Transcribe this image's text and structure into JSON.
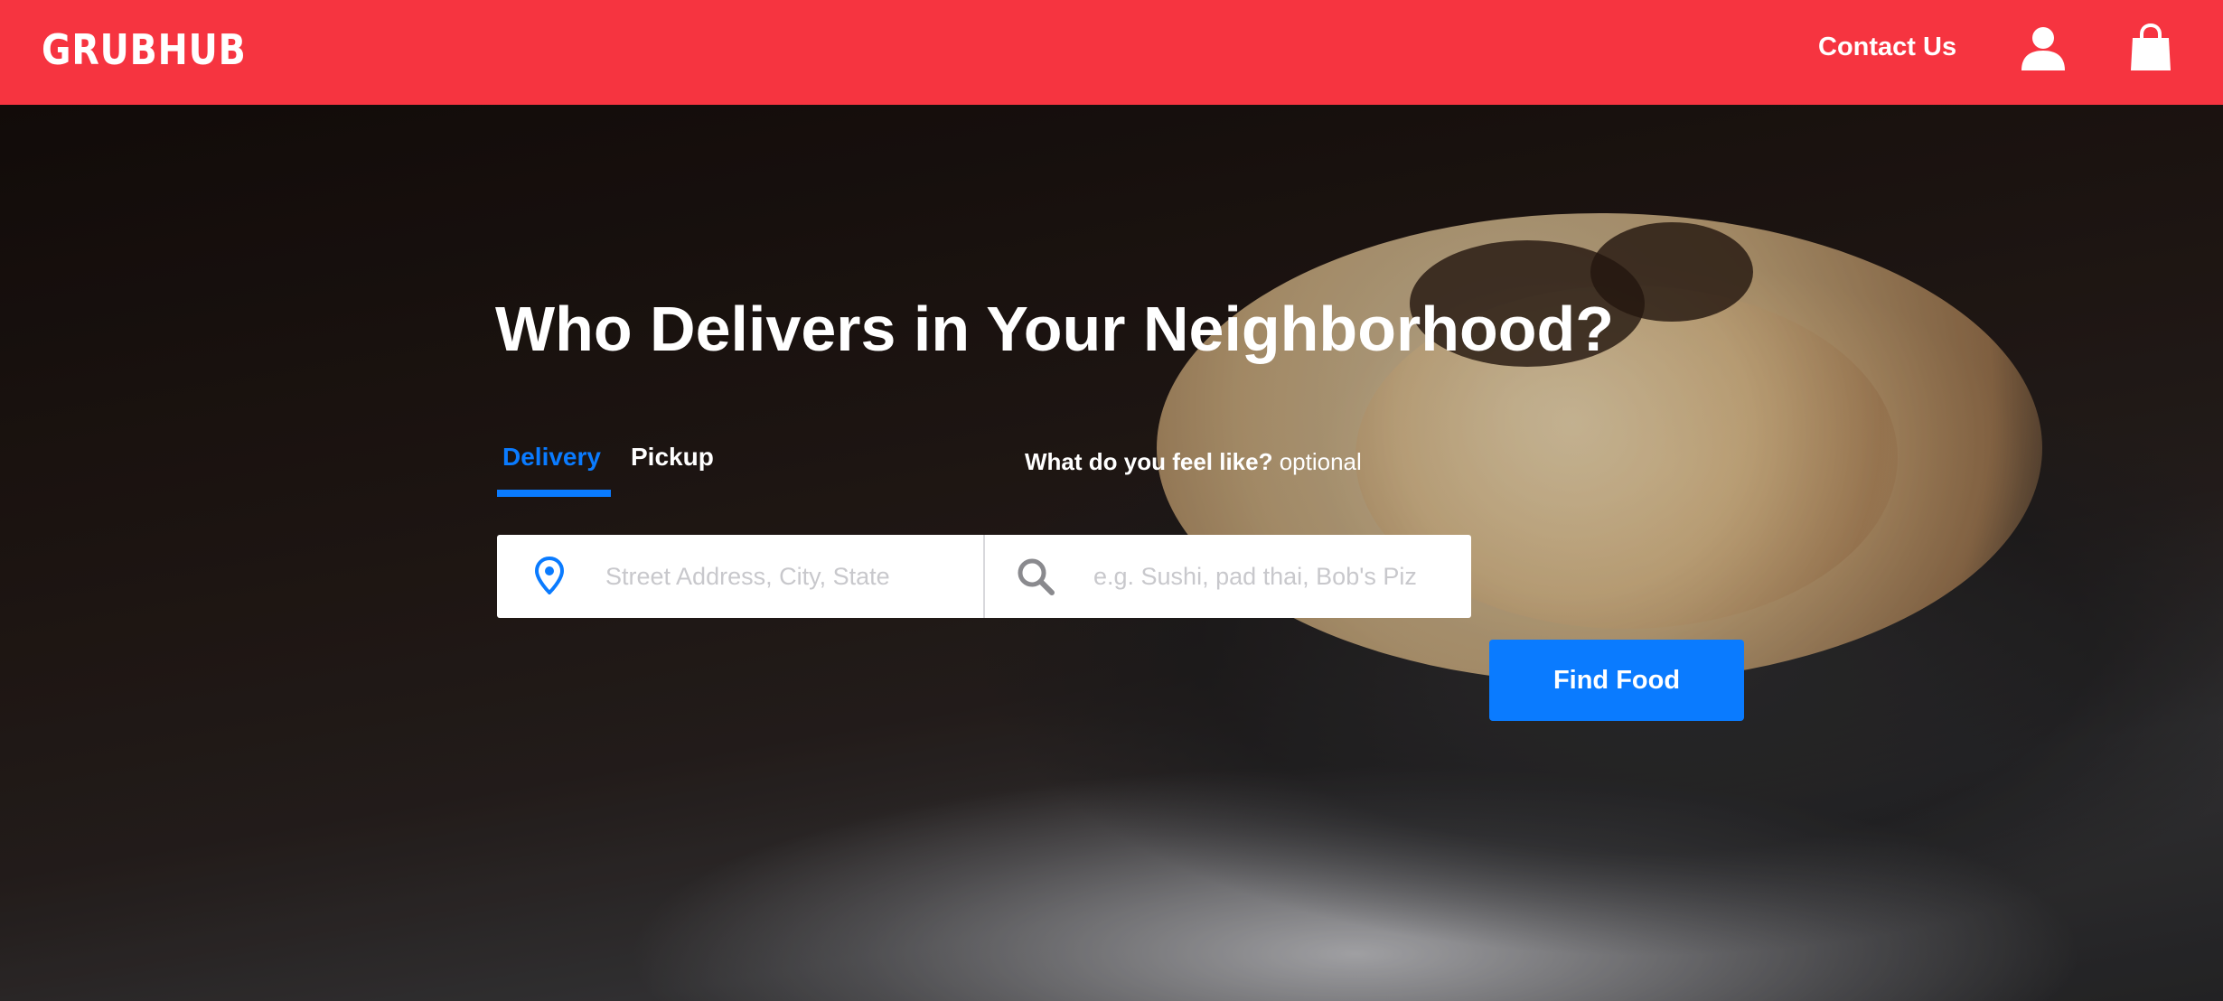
{
  "header": {
    "logo": "GRUBHUB",
    "contact_label": "Contact Us",
    "icons": [
      "user-icon",
      "shopping-bag-icon"
    ],
    "background_color": "#f63440"
  },
  "hero": {
    "headline": "Who Delivers in Your Neighborhood?",
    "tabs": [
      {
        "label": "Delivery",
        "active": true
      },
      {
        "label": "Pickup",
        "active": false
      }
    ],
    "feel_prompt_bold": "What do you feel like?",
    "feel_prompt_optional": "optional",
    "address_placeholder": "Street Address, City, State",
    "food_placeholder": "e.g. Sushi, pad thai, Bob's Piz",
    "find_button_label": "Find Food",
    "accent_color": "#0a7bff"
  }
}
